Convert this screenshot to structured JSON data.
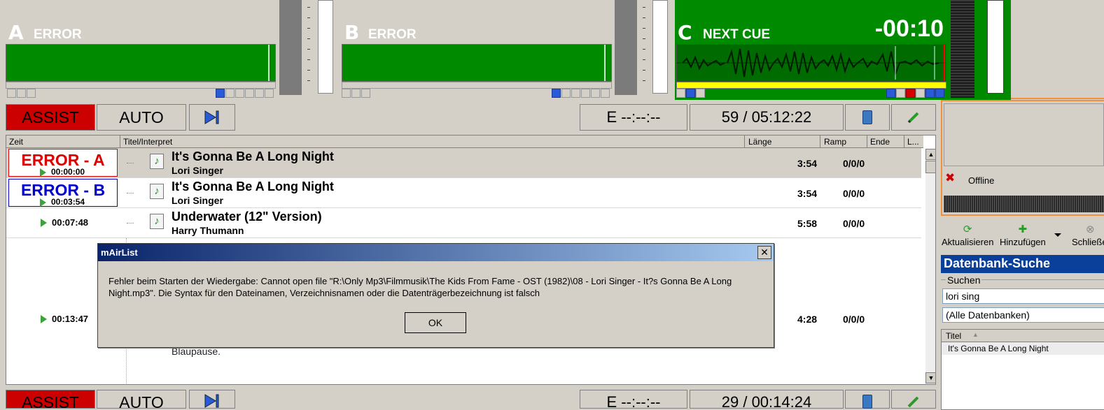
{
  "players": [
    {
      "letter": "A",
      "status": "ERROR",
      "time": ""
    },
    {
      "letter": "B",
      "status": "ERROR",
      "time": ""
    },
    {
      "letter": "C",
      "status": "NEXT CUE",
      "time": "-00:10"
    }
  ],
  "controls": {
    "assist": "ASSIST",
    "auto": "AUTO",
    "end_time": "E  --:--:--",
    "count_duration": "59 / 05:12:22"
  },
  "controls_bottom": {
    "assist": "ASSIST",
    "auto": "AUTO",
    "end_time": "E  --:--:--",
    "count_duration": "29 / 00:14:24"
  },
  "playlist": {
    "columns": {
      "zeit": "Zeit",
      "titel": "Titel/Interpret",
      "laenge": "Länge",
      "ramp": "Ramp",
      "ende": "Ende",
      "l": "L..."
    },
    "rows": [
      {
        "status": "ERROR - A",
        "time": "00:00:00",
        "title": "It's Gonna Be A Long Night",
        "artist": "Lori Singer",
        "length": "3:54",
        "ramp": "0/0/0"
      },
      {
        "status": "ERROR - B",
        "time": "00:03:54",
        "title": "It's Gonna Be A Long Night",
        "artist": "Lori Singer",
        "length": "3:54",
        "ramp": "0/0/0"
      },
      {
        "status": "",
        "time": "00:07:48",
        "title": "Underwater (12\" Version)",
        "artist": "Harry Thumann",
        "length": "5:58",
        "ramp": "0/0/0"
      },
      {
        "status": "",
        "time": "00:13:47",
        "title": "",
        "artist": "Blaupause.",
        "length": "4:28",
        "ramp": "0/0/0"
      }
    ]
  },
  "dialog": {
    "title": "mAirList",
    "message": "Fehler beim Starten der Wiedergabe: Cannot open file \"R:\\Only Mp3\\Filmmusik\\The Kids From Fame - OST (1982)\\08 - Lori Singer - It?s Gonna Be A Long Night.mp3\". Die Syntax für den Dateinamen, Verzeichnisnamen oder die Datenträgerbezeichnung ist falsch",
    "ok": "OK",
    "close": "✕"
  },
  "right_panel": {
    "status": "Offline",
    "toolbar": {
      "refresh": "Aktualisieren",
      "add": "Hinzufügen",
      "close": "Schließen"
    },
    "db_search_title": "Datenbank-Suche",
    "search_label": "Suchen",
    "search_value": "lori sing",
    "db_select": "(Alle Datenbanken)",
    "result_column": "Titel",
    "results": [
      "It's Gonna Be A Long Night"
    ]
  },
  "colors": {
    "assist_red": "#cc0000",
    "wave_green": "#008a00",
    "player_c_green": "#008a00",
    "db_title_blue": "#0a3f9a",
    "dialog_title": "#0a246a"
  }
}
